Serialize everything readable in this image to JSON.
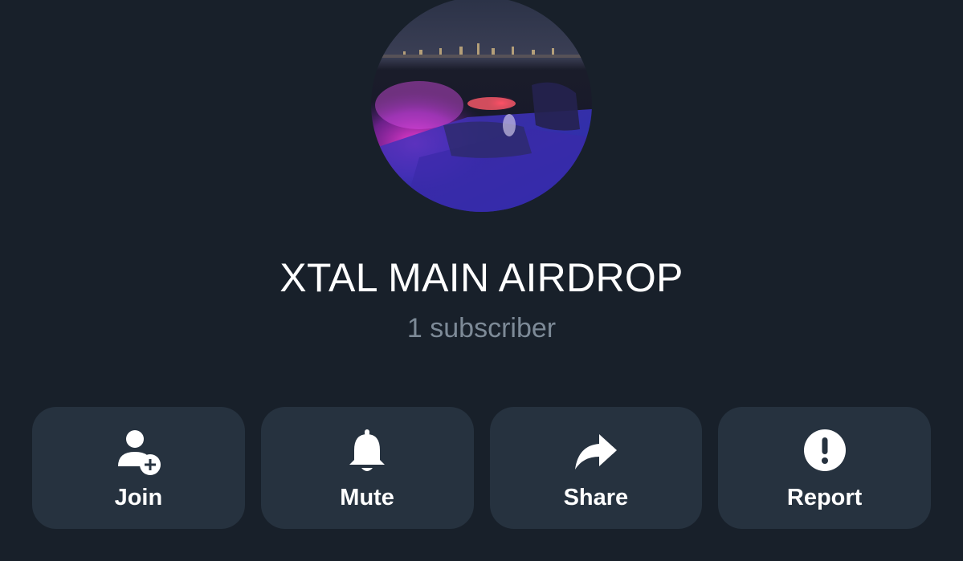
{
  "channel": {
    "title": "XTAL MAIN AIRDROP",
    "subtitle": "1 subscriber"
  },
  "actions": [
    {
      "label": "Join",
      "icon": "person-add-icon"
    },
    {
      "label": "Mute",
      "icon": "bell-icon"
    },
    {
      "label": "Share",
      "icon": "share-arrow-icon"
    },
    {
      "label": "Report",
      "icon": "exclamation-circle-icon"
    }
  ],
  "colors": {
    "background": "#18202a",
    "button_background": "#26323f",
    "title_text": "#ffffff",
    "subtitle_text": "#7d8a97"
  }
}
